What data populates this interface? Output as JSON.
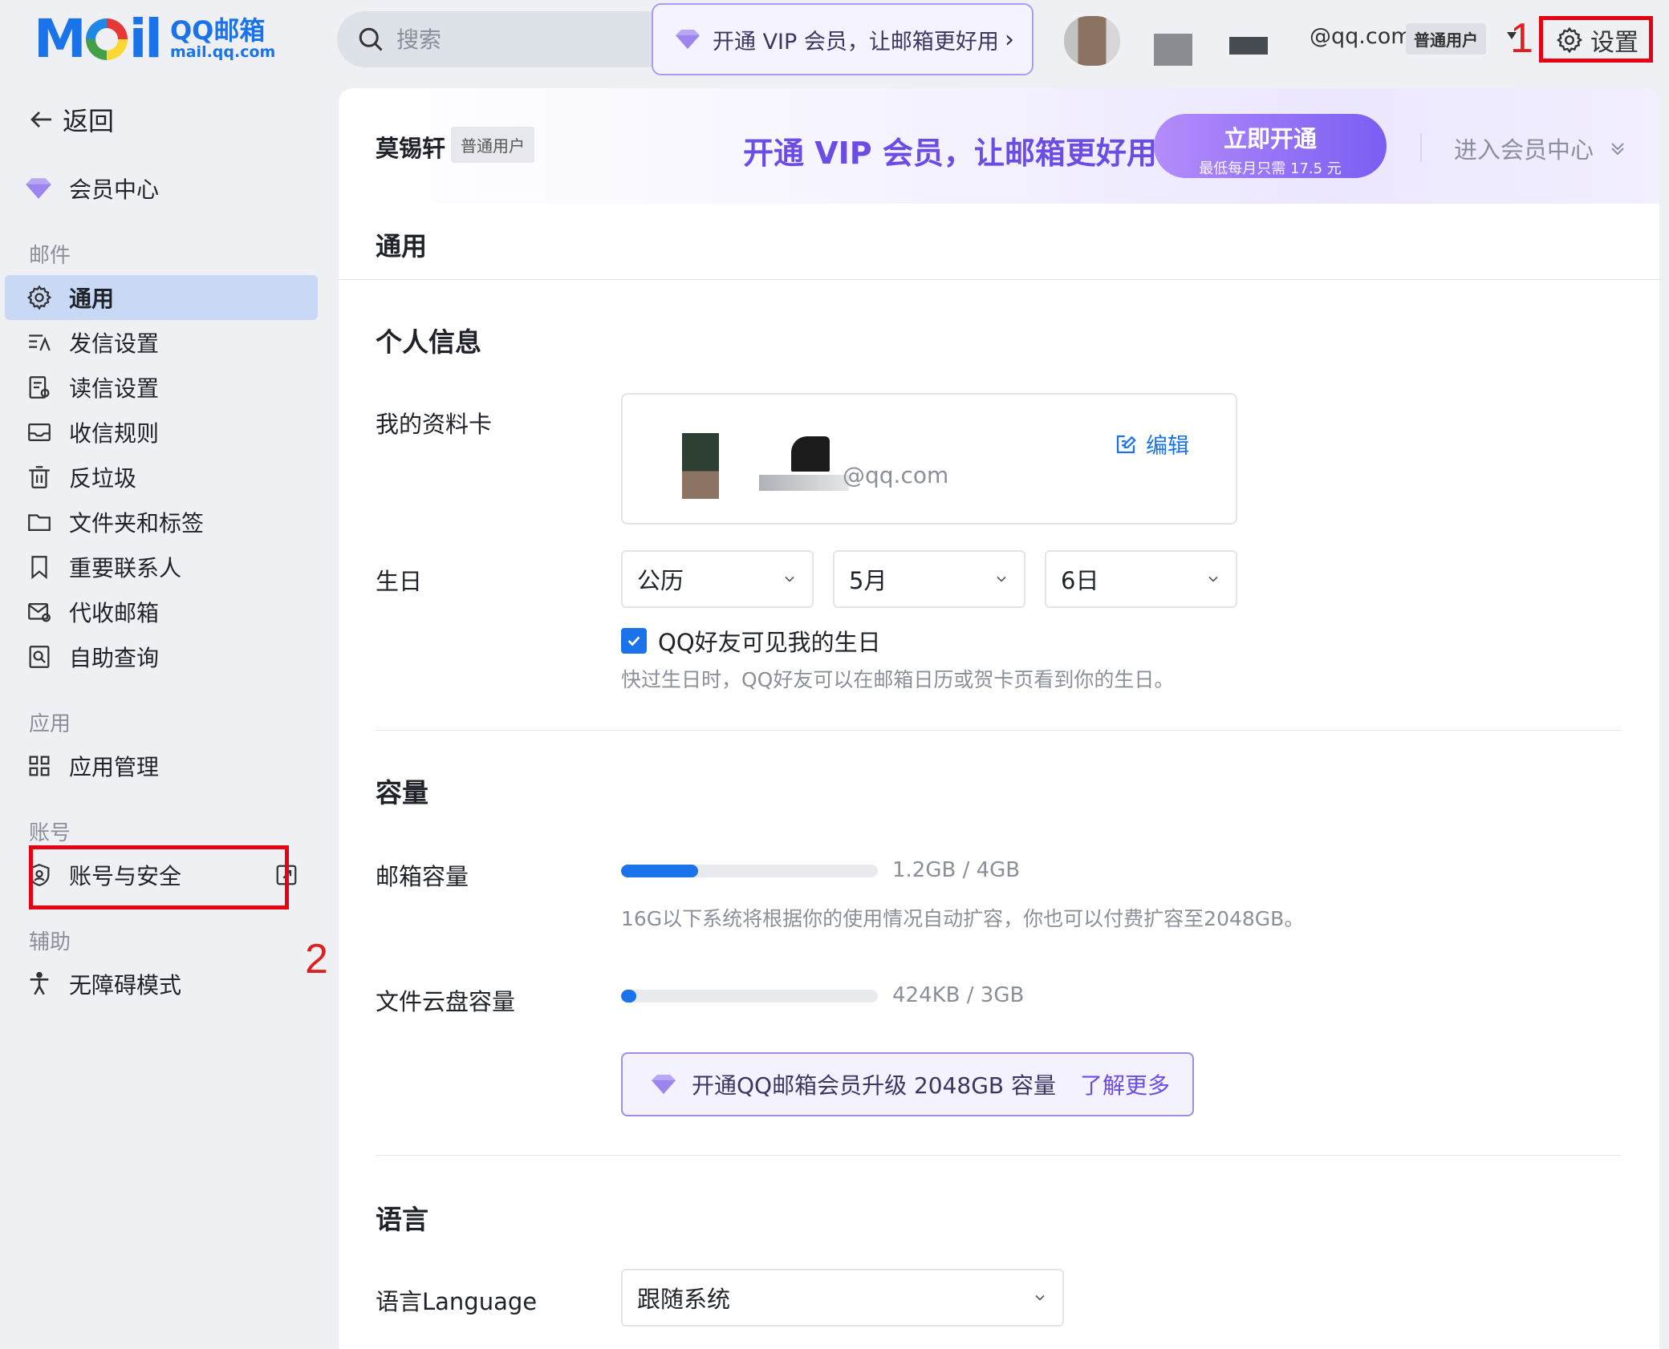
{
  "header": {
    "logo_mail": "MAil",
    "logo_cn": "QQ邮箱",
    "logo_en": "mail.qq.com",
    "search_placeholder": "搜索",
    "vip_pill": "开通 VIP 会员，让邮箱更好用",
    "account_email": "@qq.com",
    "account_badge": "普通用户",
    "annotation_1": "1",
    "settings_label": "设置"
  },
  "sidebar": {
    "back_label": "返回",
    "vip_center": "会员中心",
    "sections": {
      "mail": "邮件",
      "apps": "应用",
      "account": "账号",
      "assist": "辅助"
    },
    "mail_items": [
      {
        "label": "通用",
        "active": true
      },
      {
        "label": "发信设置"
      },
      {
        "label": "读信设置"
      },
      {
        "label": "收信规则"
      },
      {
        "label": "反垃圾"
      },
      {
        "label": "文件夹和标签"
      },
      {
        "label": "重要联系人"
      },
      {
        "label": "代收邮箱"
      },
      {
        "label": "自助查询"
      }
    ],
    "app_items": [
      {
        "label": "应用管理"
      }
    ],
    "account_items": [
      {
        "label": "账号与安全"
      }
    ],
    "assist_items": [
      {
        "label": "无障碍模式"
      }
    ],
    "annotation_2": "2"
  },
  "promo": {
    "user_name": "莫锡轩",
    "user_badge": "普通用户",
    "slogan": "开通 VIP 会员，让邮箱更好用",
    "open_btn": "立即开通",
    "open_sub": "最低每月只需 17.5 元",
    "enter_center": "进入会员中心"
  },
  "main": {
    "page_title": "通用",
    "personal": {
      "title": "个人信息",
      "card_label": "我的资料卡",
      "card_email": "@qq.com",
      "edit_label": "编辑",
      "birthday_label": "生日",
      "calendar": "公历",
      "month": "5月",
      "day": "6日",
      "checkbox_label": "QQ好友可见我的生日",
      "checkbox_checked": true,
      "birthday_hint": "快过生日时，QQ好友可以在邮箱日历或贺卡页看到你的生日。"
    },
    "capacity": {
      "title": "容量",
      "mailbox_label": "邮箱容量",
      "mailbox_usage": "1.2GB / 4GB",
      "mailbox_fraction": 0.3,
      "mailbox_hint": "16G以下系统将根据你的使用情况自动扩容，你也可以付费扩容至2048GB。",
      "cloud_label": "文件云盘容量",
      "cloud_usage": "424KB / 3GB",
      "cloud_fraction": 0.0001,
      "upgrade_text": "开通QQ邮箱会员升级 2048GB 容量",
      "learn_more": "了解更多"
    },
    "language": {
      "title": "语言",
      "label": "语言Language",
      "value": "跟随系统"
    }
  },
  "colors": {
    "accent": "#1a73e8",
    "vip_purple": "#6b4de6",
    "annotation_red": "#e60012"
  }
}
